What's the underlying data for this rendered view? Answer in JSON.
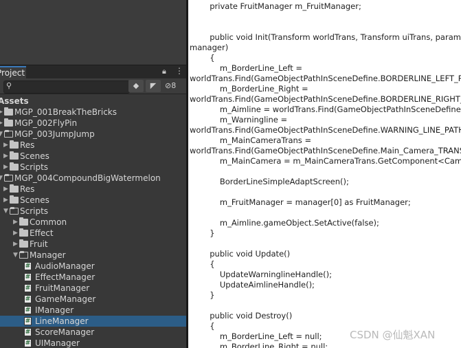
{
  "project_panel": {
    "tab_label": "Project",
    "lock_icon": "lock-icon",
    "menu_icon": "kebab-menu-icon",
    "search": {
      "placeholder": "",
      "value": ""
    },
    "hidden_count": "8",
    "tree": [
      {
        "label": "Assets",
        "depth": 0,
        "kind": "header"
      },
      {
        "label": "MGP_001BreakTheBricks",
        "depth": 1,
        "kind": "folder",
        "arrow": "right"
      },
      {
        "label": "MGP_002FlyPin",
        "depth": 1,
        "kind": "folder",
        "arrow": "right"
      },
      {
        "label": "MGP_003JumpJump",
        "depth": 1,
        "kind": "folder-open",
        "arrow": "down"
      },
      {
        "label": "Res",
        "depth": 2,
        "kind": "folder",
        "arrow": "right"
      },
      {
        "label": "Scenes",
        "depth": 2,
        "kind": "folder",
        "arrow": "right"
      },
      {
        "label": "Scripts",
        "depth": 2,
        "kind": "folder",
        "arrow": "right"
      },
      {
        "label": "MGP_004CompoundBigWatermelon",
        "depth": 1,
        "kind": "folder-open",
        "arrow": "down"
      },
      {
        "label": "Res",
        "depth": 2,
        "kind": "folder",
        "arrow": "right"
      },
      {
        "label": "Scenes",
        "depth": 2,
        "kind": "folder",
        "arrow": "right"
      },
      {
        "label": "Scripts",
        "depth": 2,
        "kind": "folder-open",
        "arrow": "down"
      },
      {
        "label": "Common",
        "depth": 3,
        "kind": "folder",
        "arrow": "right"
      },
      {
        "label": "Effect",
        "depth": 3,
        "kind": "folder",
        "arrow": "right"
      },
      {
        "label": "Fruit",
        "depth": 3,
        "kind": "folder",
        "arrow": "right"
      },
      {
        "label": "Manager",
        "depth": 3,
        "kind": "folder-open",
        "arrow": "down"
      },
      {
        "label": "AudioManager",
        "depth": 4,
        "kind": "script"
      },
      {
        "label": "EffectManager",
        "depth": 4,
        "kind": "script"
      },
      {
        "label": "FruitManager",
        "depth": 4,
        "kind": "script"
      },
      {
        "label": "GameManager",
        "depth": 4,
        "kind": "script"
      },
      {
        "label": "IManager",
        "depth": 4,
        "kind": "script"
      },
      {
        "label": "LineManager",
        "depth": 4,
        "kind": "script",
        "selected": true
      },
      {
        "label": "ScoreManager",
        "depth": 4,
        "kind": "script"
      },
      {
        "label": "UIManager",
        "depth": 4,
        "kind": "script"
      }
    ]
  },
  "code_lines": [
    "        private FruitManager m_FruitManager;",
    "",
    "",
    "        public void Init(Transform worldTrans, Transform uiTrans, params obj",
    "manager)",
    "        {",
    "            m_BorderLine_Left =",
    "worldTrans.Find(GameObjectPathInSceneDefine.BORDERLINE_LEFT_PATH",
    "            m_BorderLine_Right =",
    "worldTrans.Find(GameObjectPathInSceneDefine.BORDERLINE_RIGHT_PATH",
    "            m_Aimline = worldTrans.Find(GameObjectPathInSceneDefine.AIMLINE",
    "            m_Warningline =",
    "worldTrans.Find(GameObjectPathInSceneDefine.WARNING_LINE_PATH);",
    "            m_MainCameraTrans =",
    "worldTrans.Find(GameObjectPathInSceneDefine.Main_Camera_TRANS_PATH",
    "            m_MainCamera = m_MainCameraTrans.GetComponent<Camera>();",
    "",
    "            BorderLineSimpleAdaptScreen();",
    "",
    "            m_FruitManager = manager[0] as FruitManager;",
    "",
    "            m_Aimline.gameObject.SetActive(false);",
    "        }",
    "",
    "        public void Update()",
    "        {",
    "            UpdateWarninglineHandle();",
    "            UpdateAimlineHandle();",
    "        }",
    "",
    "        public void Destroy()",
    "        {",
    "            m_BorderLine_Left = null;",
    "            m_BorderLine_Right = null;"
  ],
  "watermark": "CSDN @仙魁XAN"
}
